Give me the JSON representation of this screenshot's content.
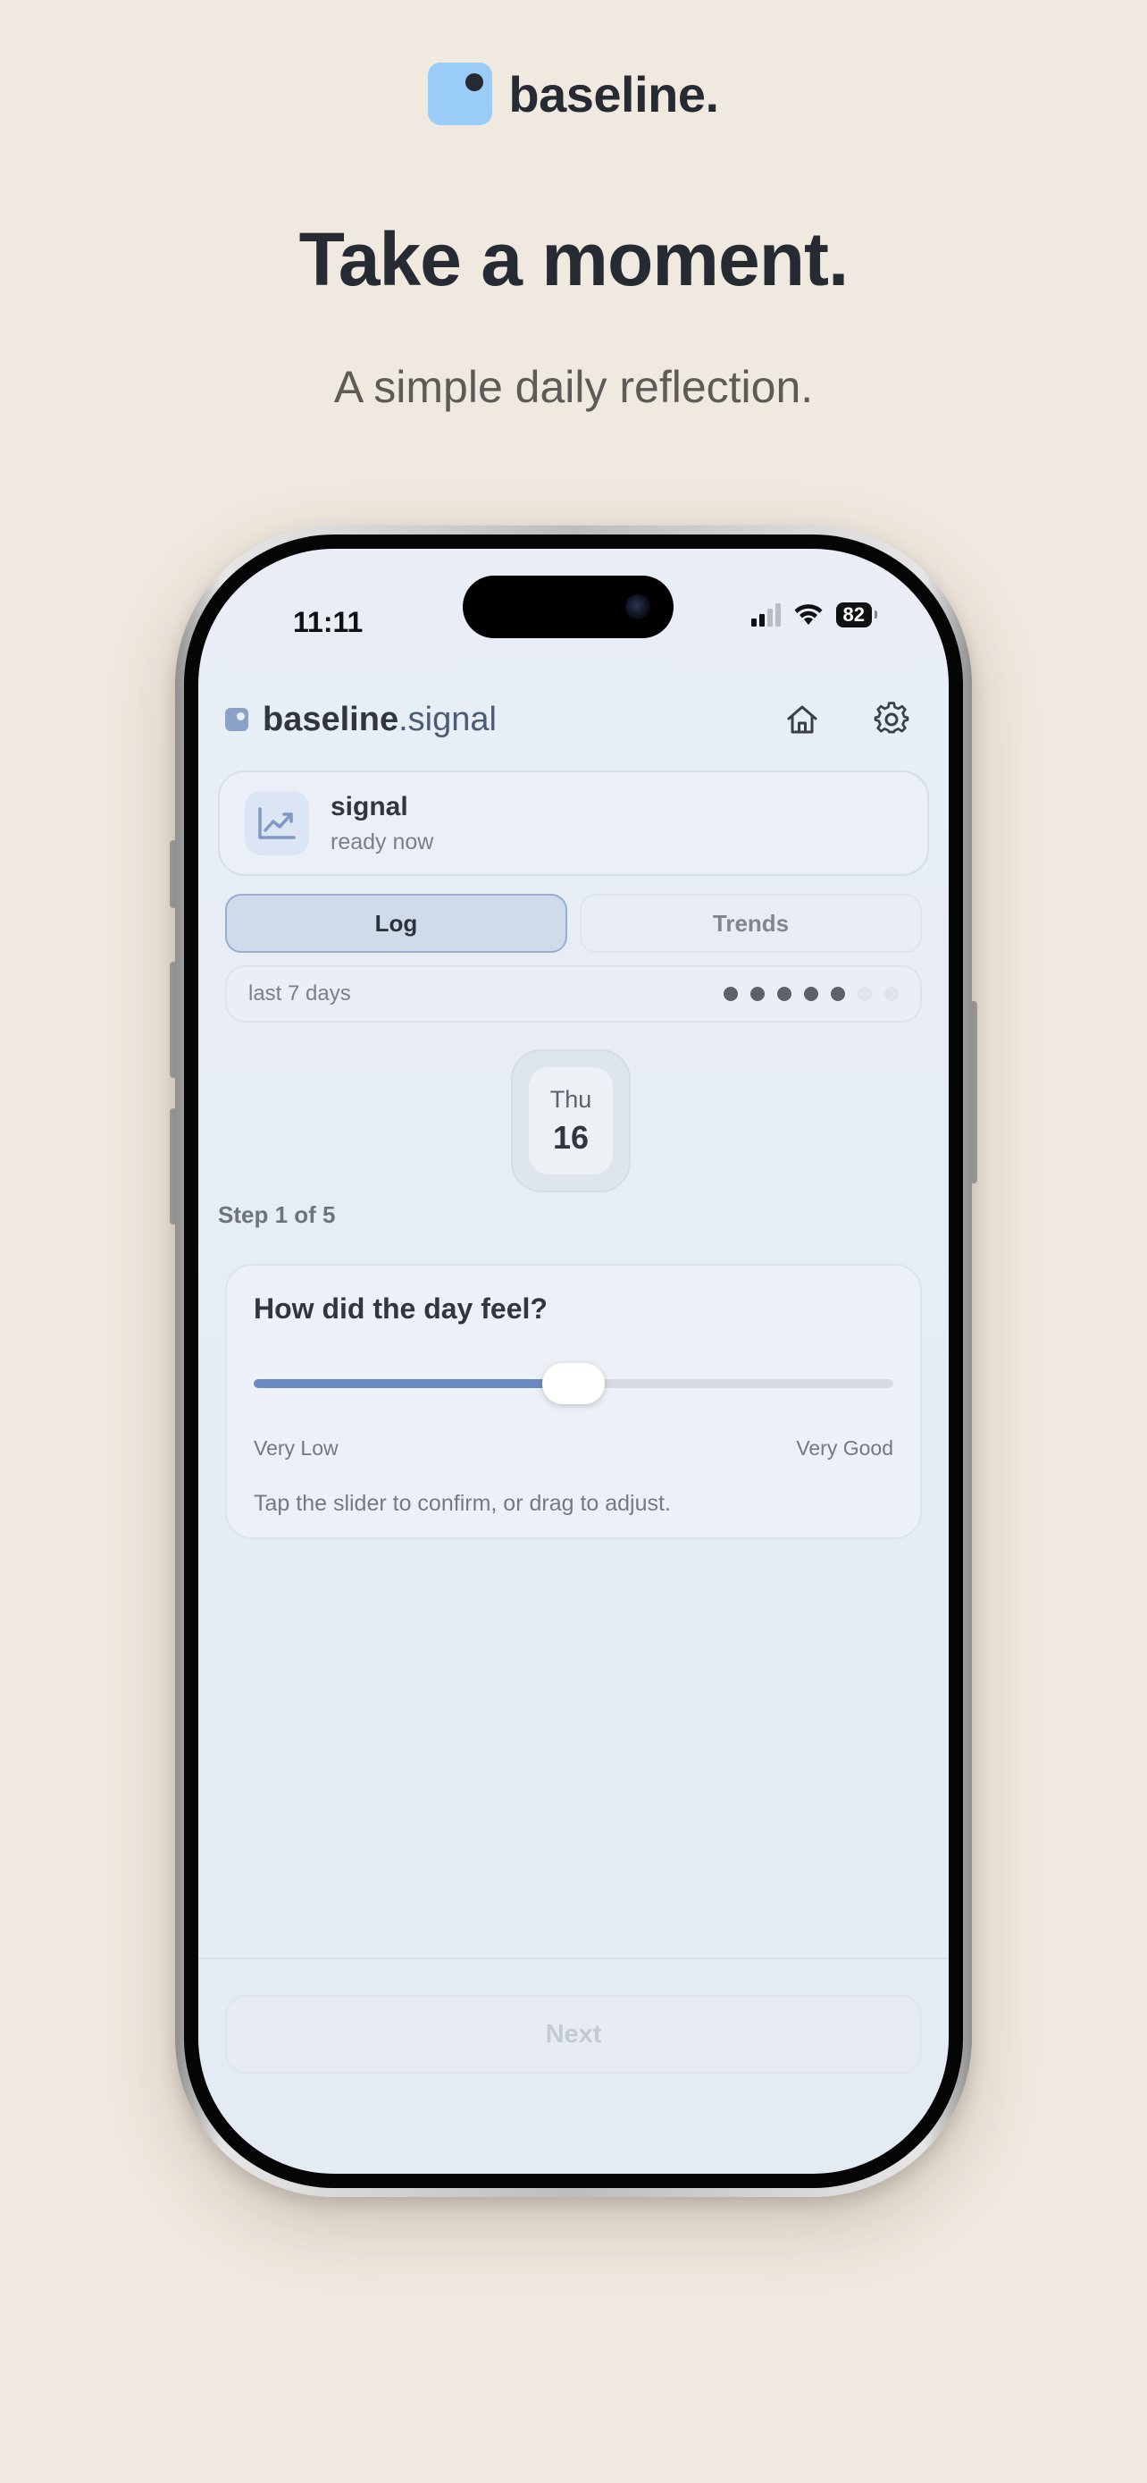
{
  "marketing": {
    "brand_name": "baseline.",
    "headline": "Take a moment.",
    "subline": "A simple daily reflection."
  },
  "status_bar": {
    "time": "11:11",
    "battery": "82"
  },
  "app": {
    "title_main": "baseline",
    "title_suffix": ".signal"
  },
  "signal_card": {
    "name": "signal",
    "status": "ready now"
  },
  "tabs": [
    {
      "label": "Log",
      "active": true
    },
    {
      "label": "Trends",
      "active": false
    }
  ],
  "history": {
    "label": "last 7 days",
    "days_logged": 5,
    "days_total": 7
  },
  "date": {
    "weekday": "Thu",
    "day": "16"
  },
  "step": {
    "label": "Step 1 of 5"
  },
  "question": {
    "prompt": "How did the day feel?",
    "min_label": "Very Low",
    "max_label": "Very Good",
    "value_fraction": 0.5,
    "hint": "Tap the slider to confirm, or drag to adjust."
  },
  "footer": {
    "next_label": "Next"
  },
  "colors": {
    "accent": "#6b8bc0",
    "background": "#f0e9df",
    "logo": "#99ccf7"
  }
}
